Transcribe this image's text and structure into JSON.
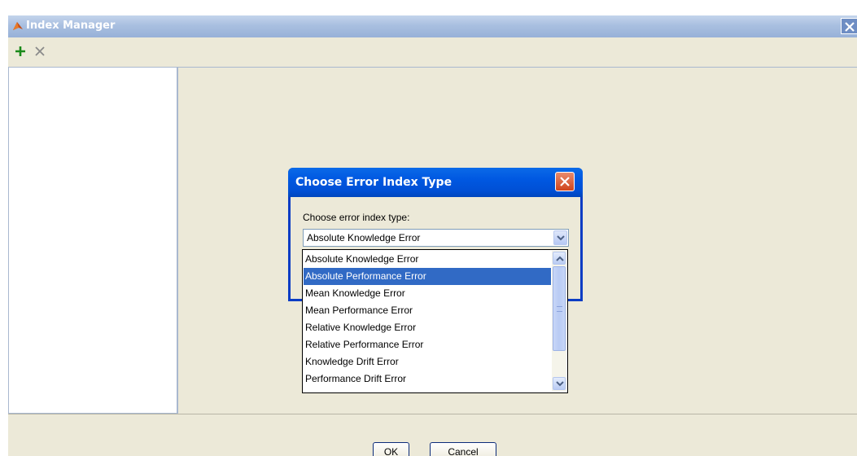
{
  "window": {
    "title": "Index Manager",
    "icons": {
      "app": "matlab-logo-icon",
      "close": "close-icon"
    }
  },
  "toolbar": {
    "add_icon": "plus-icon",
    "delete_icon": "delete-x-icon"
  },
  "dialog": {
    "title": "Choose Error Index Type",
    "label": "Choose error index type:",
    "combo_value": "Absolute Knowledge Error",
    "options": [
      "Absolute Knowledge Error",
      "Absolute Performance Error",
      "Mean Knowledge Error",
      "Mean Performance Error",
      "Relative Knowledge Error",
      "Relative Performance Error",
      "Knowledge Drift Error",
      "Performance Drift Error"
    ],
    "highlighted_option": "Absolute Performance Error"
  },
  "footer": {
    "ok_label": "OK",
    "cancel_label": "Cancel"
  },
  "colors": {
    "title_active": "#0058e1",
    "selection": "#316ac5",
    "panel_bg": "#ece9d8"
  }
}
